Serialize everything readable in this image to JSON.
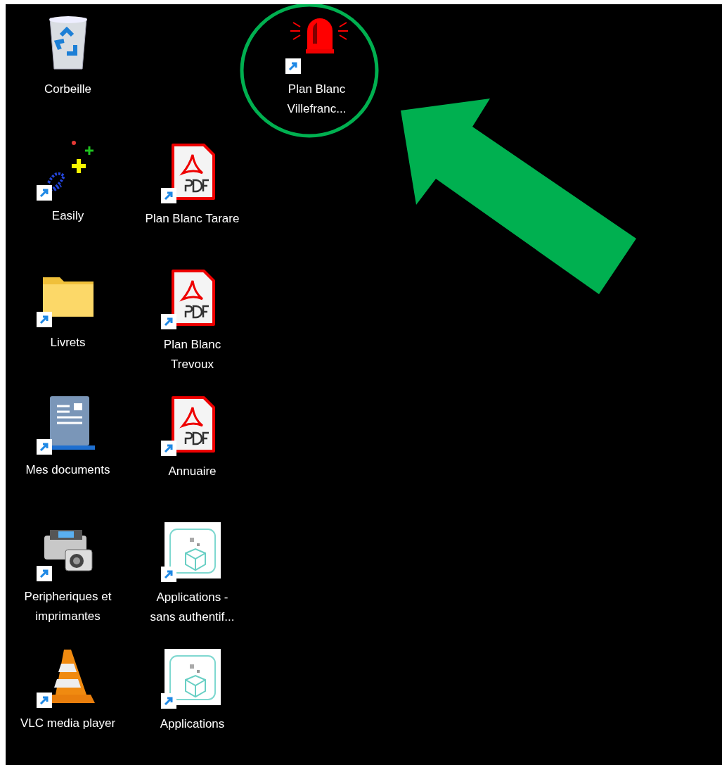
{
  "desktop": {
    "columns": [
      {
        "icons": [
          {
            "kind": "recycle-bin",
            "shortcut": false,
            "lines": [
              "Corbeille"
            ]
          },
          {
            "kind": "chain",
            "shortcut": true,
            "lines": [
              "Easily"
            ]
          },
          {
            "kind": "folder",
            "shortcut": true,
            "lines": [
              "Livrets"
            ]
          },
          {
            "kind": "document",
            "shortcut": true,
            "lines": [
              "Mes documents"
            ]
          },
          {
            "kind": "printer",
            "shortcut": true,
            "lines": [
              "Peripheriques et",
              "imprimantes"
            ]
          },
          {
            "kind": "cone",
            "shortcut": true,
            "lines": [
              "VLC media player"
            ]
          }
        ]
      },
      {
        "icons": [
          {
            "kind": "pdf",
            "shortcut": true,
            "lines": [
              "Plan Blanc Tarare"
            ]
          },
          {
            "kind": "pdf",
            "shortcut": true,
            "lines": [
              "Plan Blanc",
              "Trevoux"
            ]
          },
          {
            "kind": "pdf",
            "shortcut": true,
            "lines": [
              "Annuaire"
            ]
          },
          {
            "kind": "app",
            "shortcut": true,
            "lines": [
              "Applications -",
              "sans authentif..."
            ]
          },
          {
            "kind": "app",
            "shortcut": true,
            "lines": [
              "Applications"
            ]
          }
        ]
      },
      {
        "icons": [
          {
            "kind": "siren",
            "shortcut": true,
            "lines": [
              "Plan Blanc",
              "Villefranc..."
            ]
          }
        ]
      }
    ]
  }
}
